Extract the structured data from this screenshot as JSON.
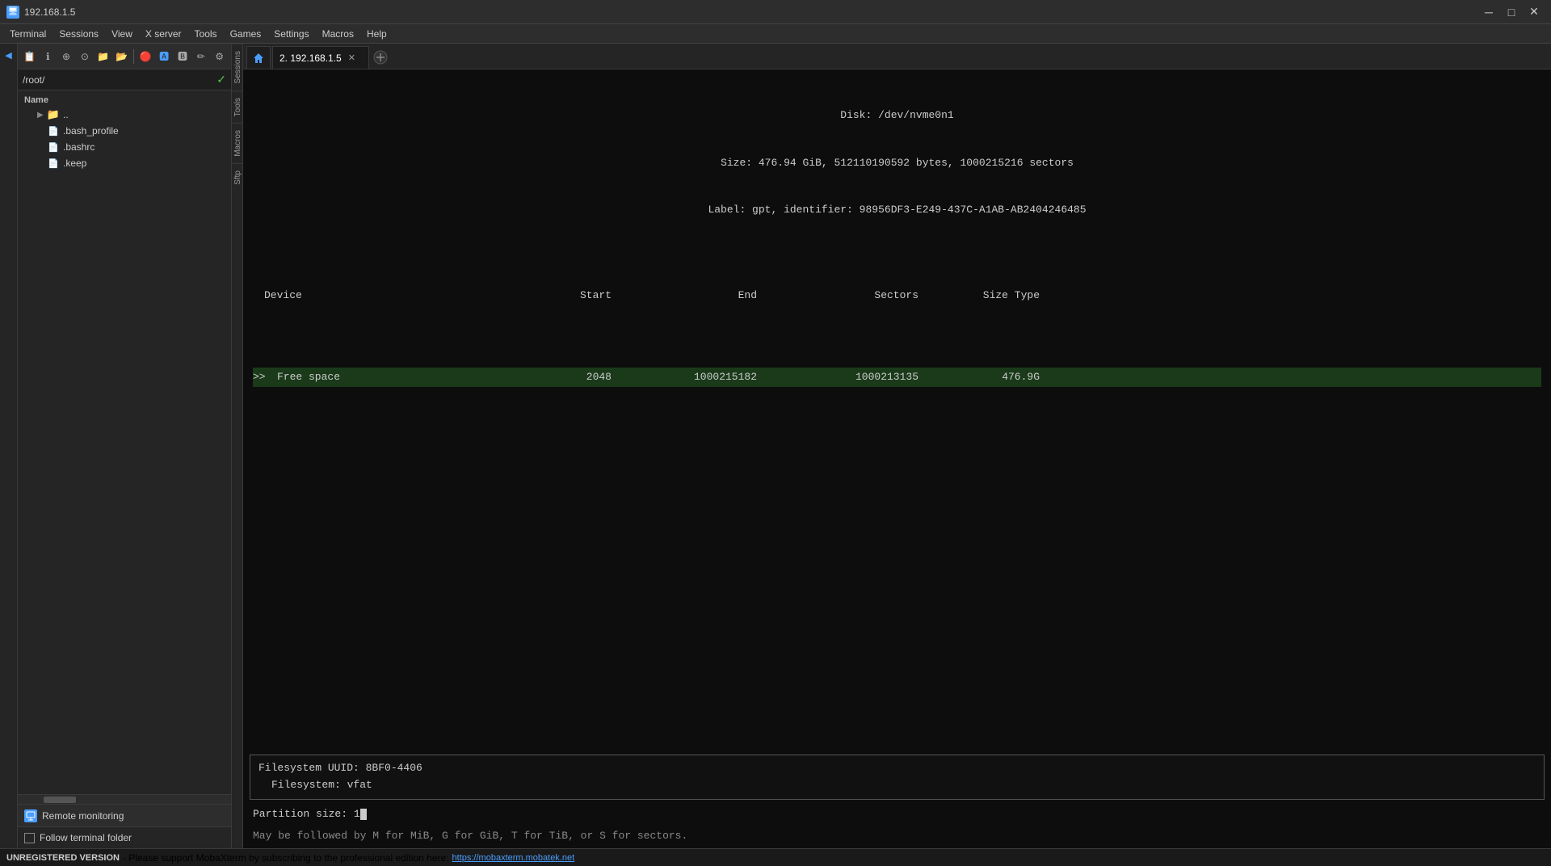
{
  "titleBar": {
    "title": "192.168.1.5",
    "icon": "🖥",
    "controls": {
      "minimize": "─",
      "maximize": "□",
      "close": "✕"
    }
  },
  "menuBar": {
    "items": [
      "Terminal",
      "Sessions",
      "View",
      "X server",
      "Tools",
      "Games",
      "Settings",
      "Macros",
      "Help"
    ]
  },
  "toolbar": {
    "buttons": [
      "📋",
      "ℹ",
      "⊕",
      "⊙",
      "📁",
      "📂",
      "🔴",
      "🅰",
      "🅱",
      "✏",
      "⚙"
    ]
  },
  "pathBar": {
    "path": "/root/",
    "checkmark": "✓"
  },
  "fileTree": {
    "header": "Name",
    "items": [
      {
        "name": "..",
        "type": "folder",
        "indent": 1
      },
      {
        "name": ".bash_profile",
        "type": "file",
        "indent": 1
      },
      {
        "name": ".bashrc",
        "type": "file",
        "indent": 1
      },
      {
        "name": ".keep",
        "type": "file",
        "indent": 1
      }
    ]
  },
  "sideLabels": [
    "Sessions",
    "Tools",
    "Macros",
    "Sftp"
  ],
  "tabs": [
    {
      "label": "2. 192.168.1.5",
      "active": true
    }
  ],
  "terminal": {
    "diskInfo": {
      "line1": "Disk: /dev/nvme0n1",
      "line2": "Size: 476.94 GiB, 512110190592 bytes, 1000215216 sectors",
      "line3": "Label: gpt, identifier: 98956DF3-E249-437C-A1AB-AB2404246485"
    },
    "tableHeaders": {
      "device": "Device",
      "start": "Start",
      "end": "End",
      "sectors": "Sectors",
      "sizeType": "Size Type"
    },
    "tableRow": {
      "pointer": ">>",
      "device": "Free space",
      "start": "2048",
      "end": "1000215182",
      "sectors": "1000213135",
      "sizeType": "476.9G"
    },
    "infoBox": {
      "uuid": "Filesystem UUID: 8BF0-4406",
      "filesystem": "Filesystem: vfat"
    },
    "inputPrompt": "Partition size: 1",
    "helpText": "May be followed by M for MiB, G for GiB, T for TiB, or S for sectors."
  },
  "bottomPanel": {
    "remoteMonitoring": "Remote monitoring",
    "followTerminalFolder": "Follow terminal folder"
  },
  "statusBar": {
    "unregistered": "UNREGISTERED VERSION",
    "message": " -  Please support MobaXterm by subscribing to the professional edition here: ",
    "link": "https://mobaxterm.mobatek.net"
  }
}
